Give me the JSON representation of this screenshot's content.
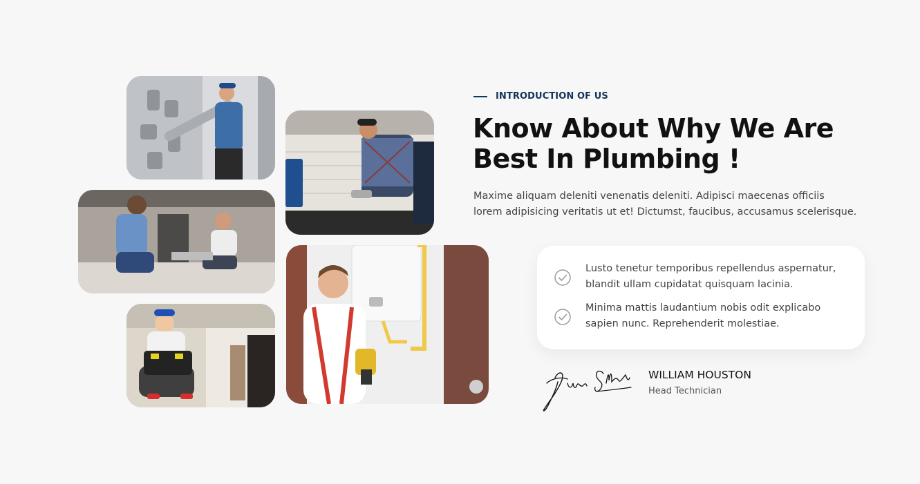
{
  "intro": {
    "eyebrow": "INTRODUCTION OF US",
    "title_line1": "Know About Why We Are",
    "title_line2": "Best In Plumbing !",
    "description_line1": "Maxime aliquam deleniti venenatis deleniti. Adipisci maecenas officiis",
    "description_line2": "lorem adipisicing veritatis ut et! Dictumst, faucibus, accusamus scelerisque."
  },
  "features": [
    {
      "icon": "check-circle-icon",
      "line1": "Lusto tenetur temporibus repellendus aspernatur,",
      "line2": "blandit ullam cupidatat quisquam lacinia."
    },
    {
      "icon": "check-circle-icon",
      "line1": "Minima mattis laudantium nobis odit explicabo",
      "line2": "sapien nunc. Reprehenderit molestiae."
    }
  ],
  "author": {
    "name": "WILLIAM HOUSTON",
    "role": "Head Technician"
  },
  "colors": {
    "background": "#f7f7f7",
    "accent": "#12345a",
    "card": "#ffffff"
  }
}
